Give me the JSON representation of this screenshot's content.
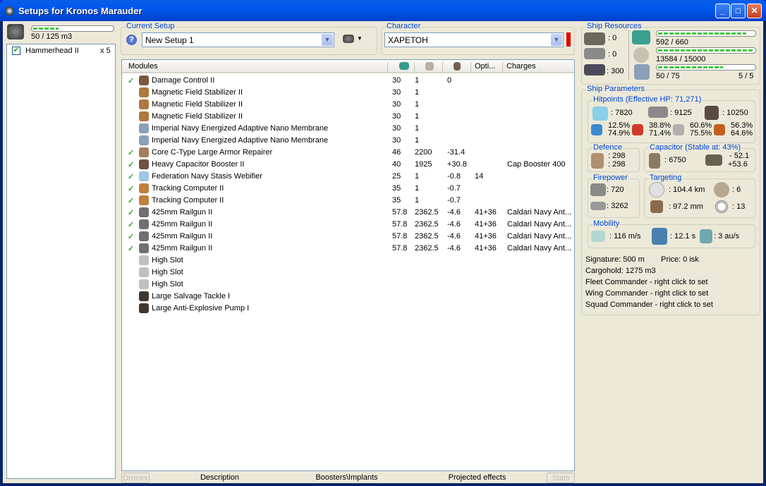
{
  "window": {
    "title": "Setups for Kronos Marauder",
    "min": "_",
    "max": "□",
    "close": "✕"
  },
  "drones": {
    "bay": "50 / 125 m3",
    "bay_fill": 0.4,
    "items": [
      {
        "name": "Hammerhead II",
        "qty": "x 5",
        "checked": true
      }
    ]
  },
  "setup": {
    "legend": "Current Setup",
    "value": "New Setup 1",
    "help": "?"
  },
  "character": {
    "legend": "Character",
    "value": "ХАРЕТОН",
    "status_color": "#e00000"
  },
  "modules": {
    "headers": [
      "Modules",
      "",
      "",
      "",
      "Opti...",
      "Charges"
    ],
    "rows": [
      {
        "active": true,
        "name": "Damage Control II",
        "cpu": "30",
        "pg": "1",
        "cap": "0",
        "opt": "",
        "charge": "",
        "icon": "#7a5a40"
      },
      {
        "active": false,
        "name": "Magnetic Field Stabilizer II",
        "cpu": "30",
        "pg": "1",
        "cap": "",
        "opt": "",
        "charge": "",
        "icon": "#b07840"
      },
      {
        "active": false,
        "name": "Magnetic Field Stabilizer II",
        "cpu": "30",
        "pg": "1",
        "cap": "",
        "opt": "",
        "charge": "",
        "icon": "#b07840"
      },
      {
        "active": false,
        "name": "Magnetic Field Stabilizer II",
        "cpu": "30",
        "pg": "1",
        "cap": "",
        "opt": "",
        "charge": "",
        "icon": "#b07840"
      },
      {
        "active": false,
        "name": "Imperial Navy Energized Adaptive Nano Membrane",
        "cpu": "30",
        "pg": "1",
        "cap": "",
        "opt": "",
        "charge": "",
        "icon": "#8aa0b8"
      },
      {
        "active": false,
        "name": "Imperial Navy Energized Adaptive Nano Membrane",
        "cpu": "30",
        "pg": "1",
        "cap": "",
        "opt": "",
        "charge": "",
        "icon": "#8aa0b8"
      },
      {
        "active": true,
        "name": "Core C-Type Large Armor Repairer",
        "cpu": "46",
        "pg": "2200",
        "cap": "-31.4",
        "opt": "",
        "charge": "",
        "icon": "#a08060"
      },
      {
        "active": true,
        "name": "Heavy Capacitor Booster II",
        "cpu": "40",
        "pg": "1925",
        "cap": "+30.8",
        "opt": "",
        "charge": "Cap Booster 400",
        "icon": "#705040"
      },
      {
        "active": true,
        "name": "Federation Navy Stasis Webifier",
        "cpu": "25",
        "pg": "1",
        "cap": "-0.8",
        "opt": "14",
        "charge": "",
        "icon": "#9cc8e0"
      },
      {
        "active": true,
        "name": "Tracking Computer II",
        "cpu": "35",
        "pg": "1",
        "cap": "-0.7",
        "opt": "",
        "charge": "",
        "icon": "#c08040"
      },
      {
        "active": true,
        "name": "Tracking Computer II",
        "cpu": "35",
        "pg": "1",
        "cap": "-0.7",
        "opt": "",
        "charge": "",
        "icon": "#c08040"
      },
      {
        "active": true,
        "name": "425mm Railgun II",
        "cpu": "57.8",
        "pg": "2362.5",
        "cap": "-4.6",
        "opt": "41+36",
        "charge": "Caldari Navy Ant...",
        "icon": "#707070"
      },
      {
        "active": true,
        "name": "425mm Railgun II",
        "cpu": "57.8",
        "pg": "2362.5",
        "cap": "-4.6",
        "opt": "41+36",
        "charge": "Caldari Navy Ant...",
        "icon": "#707070"
      },
      {
        "active": true,
        "name": "425mm Railgun II",
        "cpu": "57.8",
        "pg": "2362.5",
        "cap": "-4.6",
        "opt": "41+36",
        "charge": "Caldari Navy Ant...",
        "icon": "#707070"
      },
      {
        "active": true,
        "name": "425mm Railgun II",
        "cpu": "57.8",
        "pg": "2362.5",
        "cap": "-4.6",
        "opt": "41+36",
        "charge": "Caldari Navy Ant...",
        "icon": "#707070"
      },
      {
        "active": false,
        "name": "High Slot",
        "cpu": "",
        "pg": "",
        "cap": "",
        "opt": "",
        "charge": "",
        "icon": "#c0c0c0"
      },
      {
        "active": false,
        "name": "High Slot",
        "cpu": "",
        "pg": "",
        "cap": "",
        "opt": "",
        "charge": "",
        "icon": "#c0c0c0"
      },
      {
        "active": false,
        "name": "High Slot",
        "cpu": "",
        "pg": "",
        "cap": "",
        "opt": "",
        "charge": "",
        "icon": "#c0c0c0"
      },
      {
        "active": false,
        "name": "Large Salvage Tackle I",
        "cpu": "",
        "pg": "",
        "cap": "",
        "opt": "",
        "charge": "",
        "icon": "#403830"
      },
      {
        "active": false,
        "name": "Large Anti-Explosive Pump I",
        "cpu": "",
        "pg": "",
        "cap": "",
        "opt": "",
        "charge": "",
        "icon": "#403830"
      }
    ]
  },
  "tabs": {
    "drones": "Drones",
    "description": "Description",
    "boosters": "Boosters\\Implants",
    "projected": "Projected effects",
    "stats": "Stats"
  },
  "resources": {
    "legend": "Ship Resources",
    "turrets": ": 0",
    "launchers": ": 0",
    "calibration": ": 300",
    "cpu": "592 / 660",
    "cpu_fill": 0.897,
    "pg": "13584 / 15000",
    "pg_fill": 0.906,
    "drone_bw": "50 / 75",
    "drone_fill": 0.667,
    "drones_active": "5 / 5"
  },
  "params": {
    "legend": "Ship Parameters",
    "hp": {
      "legend": "Hitpoints (Effective HP: 71,271)",
      "shield": ": 7820",
      "armor": ": 9125",
      "structure": ": 10250",
      "resists": [
        {
          "top": "12.5%",
          "bot": "74.9%",
          "color": "#3a8ad0"
        },
        {
          "top": "38.8%",
          "bot": "71.4%",
          "color": "#d03a2a"
        },
        {
          "top": "60.6%",
          "bot": "75.5%",
          "color": "#b0b0b0"
        },
        {
          "top": "56.3%",
          "bot": "64.6%",
          "color": "#c06020"
        }
      ]
    },
    "defence": {
      "legend": "Defence",
      "a": ": 298",
      "b": ": 298"
    },
    "capacitor": {
      "legend": "Capacitor (Stable at: 43%)",
      "amount": ": 6750",
      "use": "- 52.1",
      "regen": "+53.6"
    },
    "firepower": {
      "legend": "Firepower",
      "turret": ": 720",
      "volley": ": 3262"
    },
    "targeting": {
      "legend": "Targeting",
      "range": ": 104.4 km",
      "targets": ": 6",
      "scan": ": 97.2 mm",
      "sensor": ": 13"
    },
    "mobility": {
      "legend": "Mobility",
      "speed": ": 116 m/s",
      "align": ": 12.1 s",
      "warp": ": 3 au/s"
    },
    "signature": "Signature: 500 m",
    "price": "Price: 0 isk",
    "cargo": "Cargohold: 1275 m3",
    "fleet": "Fleet Commander - right click to set",
    "wing": "Wing Commander - right click to set",
    "squad": "Squad Commander - right click to set"
  }
}
